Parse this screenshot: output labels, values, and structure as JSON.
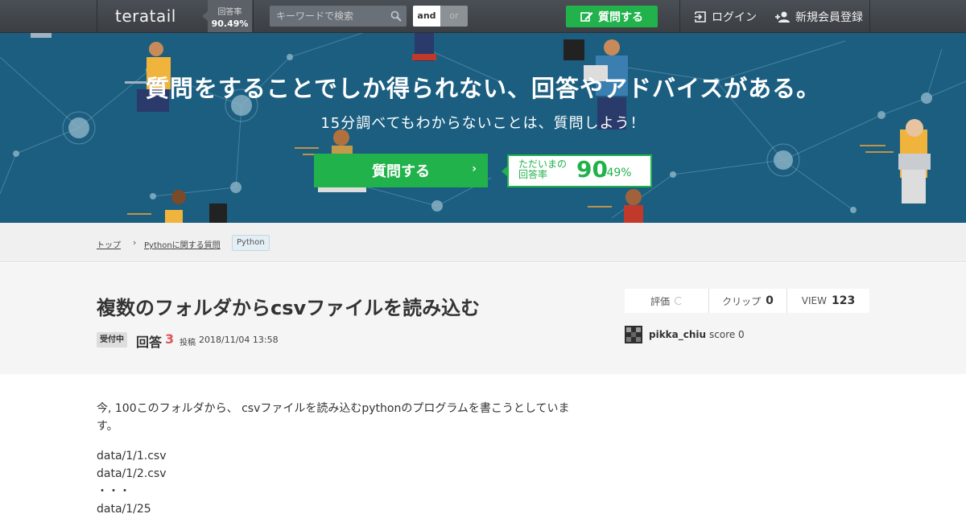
{
  "header": {
    "logo": "teratail",
    "rate_label": "回答率",
    "rate_value": "90.49%",
    "search_placeholder": "キーワードで検索",
    "and_label": "and",
    "or_label": "or",
    "ask_label": "質問する",
    "login_label": "ログイン",
    "register_label": "新規会員登録"
  },
  "hero": {
    "title": "質問をすることでしか得られない、回答やアドバイスがある。",
    "subtitle": "15分調べてもわからないことは、質問しよう！",
    "ask_label": "質問する",
    "rate_label": "ただいまの回答率",
    "rate_big": "90",
    "rate_small": ".49%"
  },
  "breadcrumb": {
    "items": [
      "トップ",
      "Pythonに関する質問"
    ],
    "tag": "Python"
  },
  "question": {
    "title": "複数のフォルダからcsvファイルを読み込む",
    "status": "受付中",
    "answers_label": "回答",
    "answers_count": "3",
    "posted_label": "投稿",
    "posted_date": "2018/11/04 13:58",
    "stats": {
      "rating_label": "評価",
      "clip_label": "クリップ",
      "clip_value": "0",
      "view_label": "VIEW",
      "view_value": "123"
    },
    "author": {
      "name": "pikka_chiu",
      "score": "score 0"
    },
    "body": {
      "intro": "今, 100このフォルダから、 csvファイルを読み込むpythonのプログラムを書こうとしています。",
      "lines": [
        "data/1/1.csv",
        "data/1/2.csv",
        "・・・",
        "data/1/25"
      ]
    }
  },
  "colors": {
    "header_bg": "#3f4449",
    "accent_green": "#22b24c",
    "hero_bg": "#1b5e80",
    "answer_count": "#e0555b"
  }
}
